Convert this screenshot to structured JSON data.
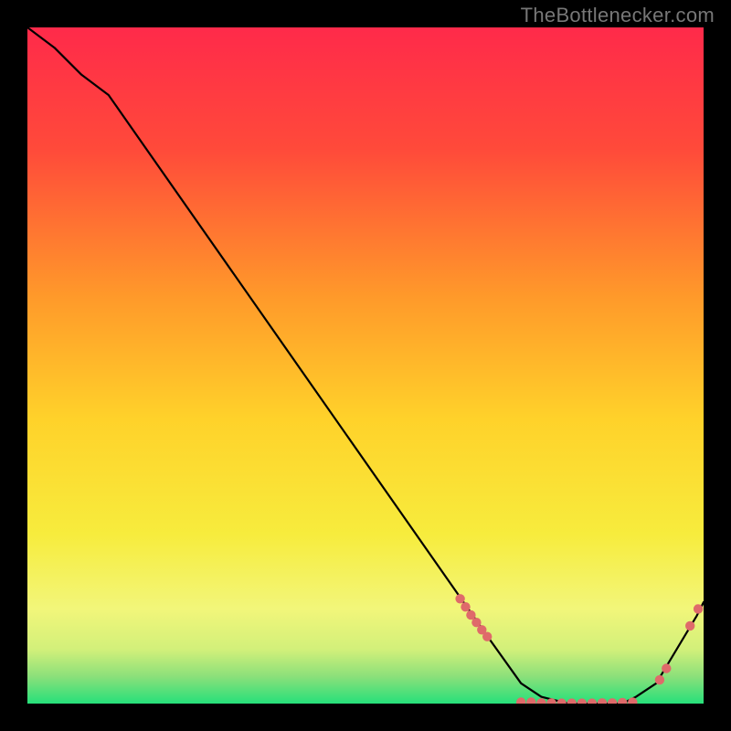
{
  "watermark": "TheBottlenecker.com",
  "chart_data": {
    "type": "line",
    "title": "",
    "xlabel": "",
    "ylabel": "",
    "xlim": [
      0,
      100
    ],
    "ylim": [
      0,
      100
    ],
    "grid": false,
    "legend": false,
    "background_gradient": {
      "top": "#ff2a4a",
      "upper_mid": "#ff8a2a",
      "mid": "#ffd62a",
      "lower_mid": "#f6f45a",
      "bottom": "#26e07a"
    },
    "series": [
      {
        "name": "bottleneck-curve",
        "x": [
          0,
          4,
          8,
          12,
          68,
          73,
          76,
          80,
          84,
          88,
          90,
          93,
          96,
          99,
          100
        ],
        "y": [
          100,
          97,
          93,
          90,
          10,
          3,
          1,
          0,
          0,
          0,
          1,
          3,
          8,
          13,
          15
        ]
      }
    ],
    "marker_groups": [
      {
        "name": "cluster-left-of-valley",
        "approx_x_range": [
          64,
          70
        ],
        "approx_y_range": [
          10,
          17
        ],
        "count_estimate": 8,
        "color": "#df6a6a",
        "points": [
          {
            "x": 64.0,
            "y": 15.5
          },
          {
            "x": 64.8,
            "y": 14.3
          },
          {
            "x": 65.6,
            "y": 13.1
          },
          {
            "x": 66.4,
            "y": 12.0
          },
          {
            "x": 67.2,
            "y": 10.9
          },
          {
            "x": 68.0,
            "y": 9.9
          }
        ]
      },
      {
        "name": "cluster-valley-flat",
        "approx_x_range": [
          73,
          90
        ],
        "approx_y_range": [
          0,
          1
        ],
        "count_estimate": 18,
        "color": "#df6a6a",
        "points": [
          {
            "x": 73,
            "y": 0.2
          },
          {
            "x": 74.5,
            "y": 0.2
          },
          {
            "x": 76,
            "y": 0.1
          },
          {
            "x": 77.5,
            "y": 0.1
          },
          {
            "x": 79,
            "y": 0.05
          },
          {
            "x": 80.5,
            "y": 0.05
          },
          {
            "x": 82,
            "y": 0.05
          },
          {
            "x": 83.5,
            "y": 0.05
          },
          {
            "x": 85,
            "y": 0.1
          },
          {
            "x": 86.5,
            "y": 0.1
          },
          {
            "x": 88,
            "y": 0.15
          },
          {
            "x": 89.5,
            "y": 0.2
          }
        ]
      },
      {
        "name": "cluster-right-rise",
        "approx_x_range": [
          93,
          100
        ],
        "approx_y_range": [
          3,
          15
        ],
        "count_estimate": 5,
        "color": "#df6a6a",
        "points": [
          {
            "x": 93.5,
            "y": 3.5
          },
          {
            "x": 94.5,
            "y": 5.2
          },
          {
            "x": 98.0,
            "y": 11.5
          },
          {
            "x": 99.2,
            "y": 14.0
          }
        ]
      }
    ]
  }
}
